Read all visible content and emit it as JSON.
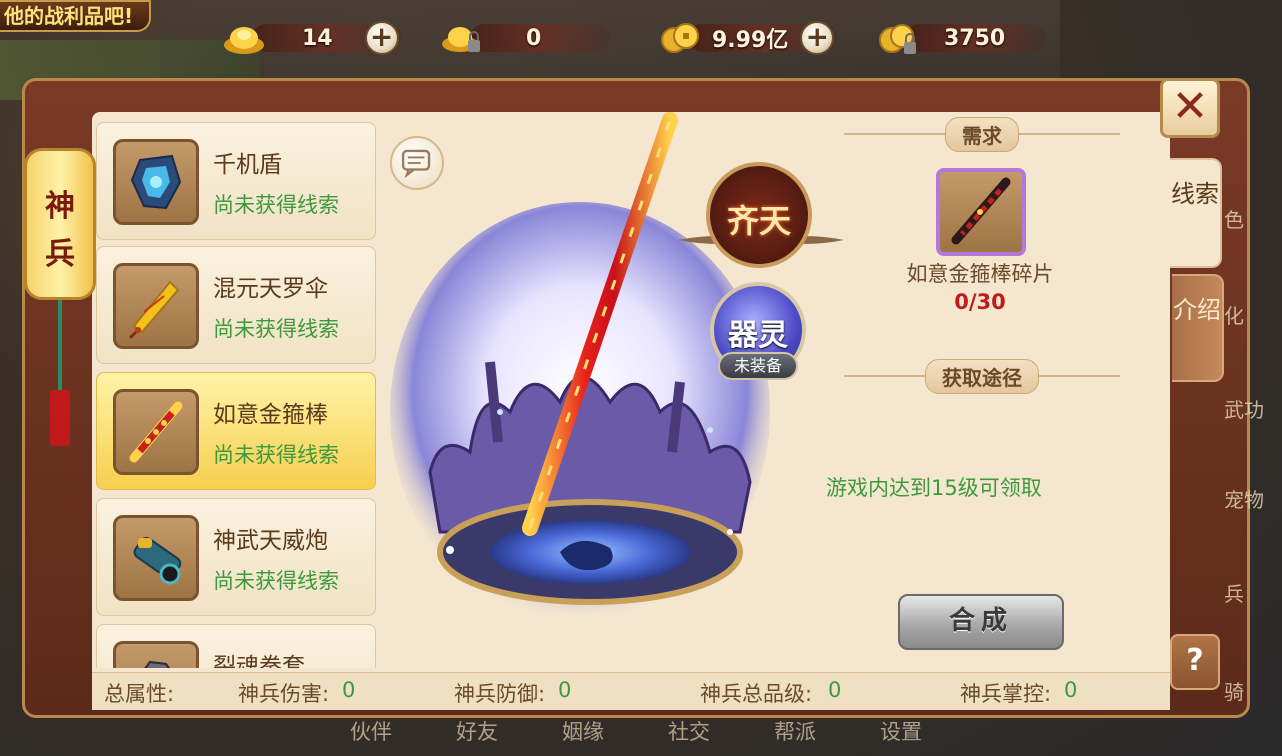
{
  "banner": {
    "text": "他的战利品吧!"
  },
  "currency": {
    "gold_ingot": "14",
    "bound_ingot": "0",
    "coins": "9.99亿",
    "bound_coins": "3750"
  },
  "lantern": {
    "line1": "神",
    "line2": "兵"
  },
  "items": [
    {
      "name": "千机盾",
      "status": "尚未获得线索",
      "selected": false
    },
    {
      "name": "混元天罗伞",
      "status": "尚未获得线索",
      "selected": false
    },
    {
      "name": "如意金箍棒",
      "status": "尚未获得线索",
      "selected": true
    },
    {
      "name": "神武天威炮",
      "status": "尚未获得线索",
      "selected": false
    },
    {
      "name": "裂魂拳套",
      "status": "",
      "selected": false
    }
  ],
  "display": {
    "badge": "齐天",
    "qiling": "器灵",
    "qiling_status": "未装备"
  },
  "requirement": {
    "title": "需求",
    "fragment_name": "如意金箍棒碎片",
    "fragment_count": "0/30"
  },
  "source": {
    "title": "获取途径",
    "text": "游戏内达到15级可领取"
  },
  "compose_label": "合成",
  "stats": {
    "total_label": "总属性:",
    "damage_label": "神兵伤害:",
    "damage_value": "0",
    "defense_label": "神兵防御:",
    "defense_value": "0",
    "grade_label": "神兵总品级:",
    "grade_value": "0",
    "control_label": "神兵掌控:",
    "control_value": "0"
  },
  "tabs": {
    "clues": "线索",
    "intro": "介绍"
  },
  "close_label": "✕",
  "help_label": "?",
  "bottom_nav": [
    "伙伴",
    "好友",
    "姻缘",
    "社交",
    "帮派",
    "设置"
  ],
  "right_nav": [
    "色",
    "化",
    "武功",
    "宠物",
    "兵",
    "骑"
  ],
  "colors": {
    "accent_green": "#3c9a3c",
    "accent_red": "#c01a1a",
    "selected_bg": "#f6cf4e",
    "panel_bg": "#f4e6cf"
  }
}
